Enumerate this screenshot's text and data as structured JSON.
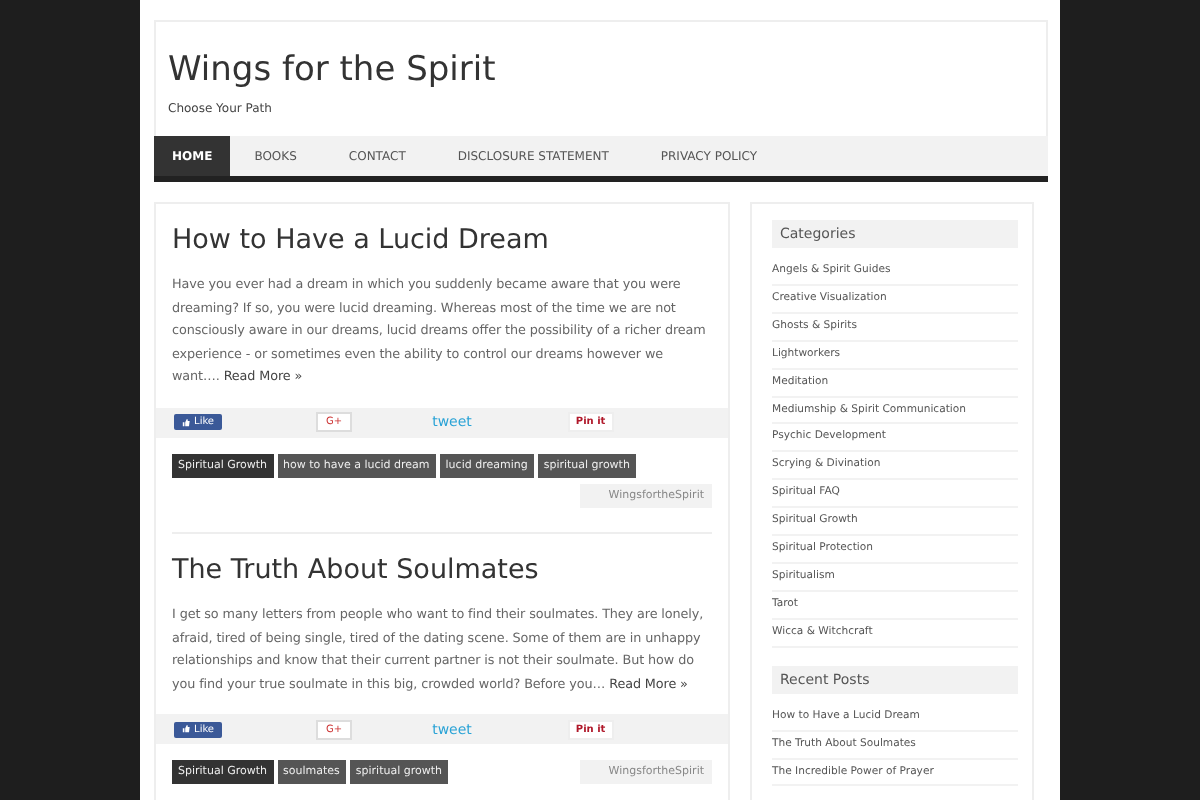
{
  "site": {
    "title": "Wings for the Spirit",
    "tagline": "Choose Your Path"
  },
  "nav": [
    {
      "label": "HOME",
      "selected": true
    },
    {
      "label": "BOOKS",
      "selected": false
    },
    {
      "label": "CONTACT",
      "selected": false
    },
    {
      "label": "DISCLOSURE STATEMENT",
      "selected": false
    },
    {
      "label": "PRIVACY POLICY",
      "selected": false
    }
  ],
  "posts": [
    {
      "title": "How to Have a Lucid Dream",
      "excerpt": "Have you ever had a dream in which you suddenly became aware that you were dreaming? If so, you were lucid dreaming. Whereas most of the time we are not consciously aware in our dreams, lucid dreams offer the possibility of a richer dream experience - or sometimes even the ability to control our dreams however we want….",
      "read_more": "Read More »",
      "share": {
        "like": "Like",
        "gplus": "G+",
        "tweet": "tweet",
        "pin": "Pin it"
      },
      "tags": [
        {
          "label": "Spiritual Growth",
          "kind": "category"
        },
        {
          "label": "how to have a lucid dream",
          "kind": "tag"
        },
        {
          "label": "lucid dreaming",
          "kind": "tag"
        },
        {
          "label": "spiritual growth",
          "kind": "tag"
        }
      ],
      "author": "WingsfortheSpirit"
    },
    {
      "title": "The Truth About Soulmates",
      "excerpt": "I get so many letters from people who want to find their soulmates. They are lonely, afraid, tired of being single, tired of the dating scene. Some of them are in unhappy relationships and know that their current partner is not their soulmate. But how do you find your true soulmate in this big, crowded world? Before you…",
      "read_more": "Read More »",
      "share": {
        "like": "Like",
        "gplus": "G+",
        "tweet": "tweet",
        "pin": "Pin it"
      },
      "tags": [
        {
          "label": "Spiritual Growth",
          "kind": "category"
        },
        {
          "label": "soulmates",
          "kind": "tag"
        },
        {
          "label": "spiritual growth",
          "kind": "tag"
        }
      ],
      "author": "WingsfortheSpirit"
    }
  ],
  "sidebar": [
    {
      "title": "Categories",
      "items": [
        "Angels & Spirit Guides",
        "Creative Visualization",
        "Ghosts & Spirits",
        "Lightworkers",
        "Meditation",
        "Mediumship & Spirit Communication",
        "Psychic Development",
        "Scrying & Divination",
        "Spiritual FAQ",
        "Spiritual Growth",
        "Spiritual Protection",
        "Spiritualism",
        "Tarot",
        "Wicca & Witchcraft"
      ]
    },
    {
      "title": "Recent Posts",
      "items": [
        "How to Have a Lucid Dream",
        "The Truth About Soulmates",
        "The Incredible Power of Prayer"
      ]
    }
  ]
}
